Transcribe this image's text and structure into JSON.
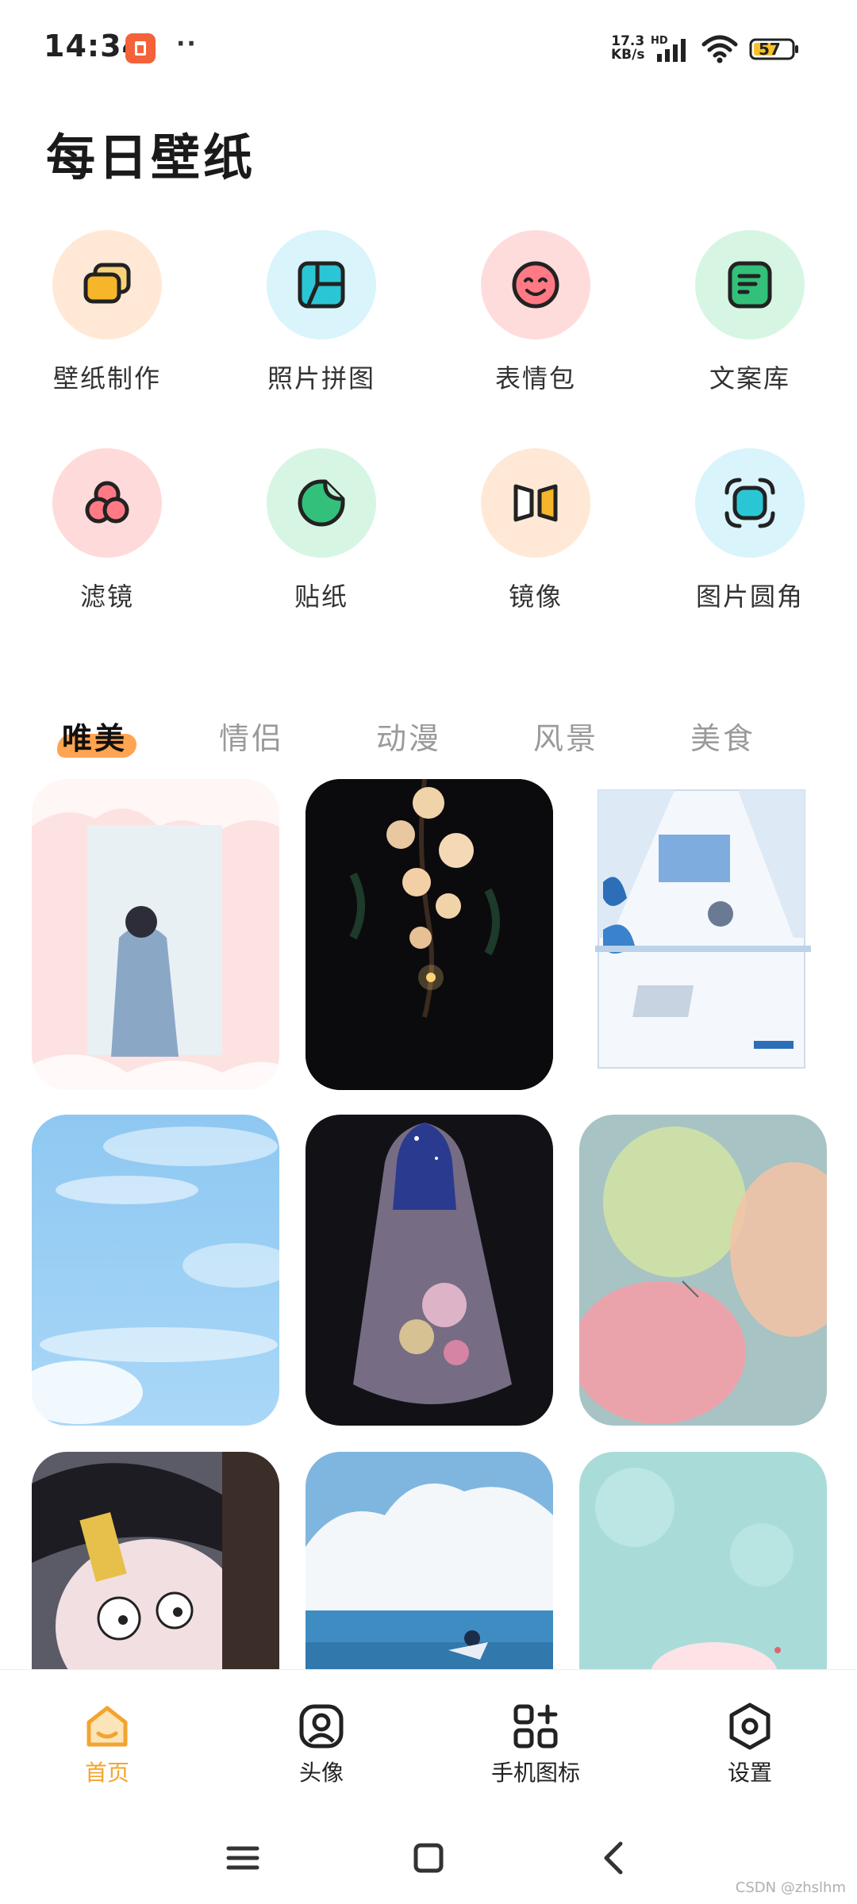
{
  "status_bar": {
    "time": "14:34",
    "net_speed_value": "17.3",
    "net_speed_unit": "KB/s",
    "hd": "HD",
    "battery": "57"
  },
  "page_title": "每日壁纸",
  "features": [
    {
      "label": "壁纸制作",
      "icon": "layers-icon",
      "bg": "#ffe9d6",
      "accent": "#f7b529"
    },
    {
      "label": "照片拼图",
      "icon": "collage-icon",
      "bg": "#d9f4fb",
      "accent": "#2bc6d6"
    },
    {
      "label": "表情包",
      "icon": "smile-icon",
      "bg": "#ffdcdc",
      "accent": "#ff6e79"
    },
    {
      "label": "文案库",
      "icon": "document-icon",
      "bg": "#d6f6e3",
      "accent": "#33c07a"
    },
    {
      "label": "滤镜",
      "icon": "filter-icon",
      "bg": "#ffdada",
      "accent": "#ff6e79"
    },
    {
      "label": "贴纸",
      "icon": "sticker-icon",
      "bg": "#d6f6e3",
      "accent": "#33c07a"
    },
    {
      "label": "镜像",
      "icon": "mirror-icon",
      "bg": "#ffe9d6",
      "accent": "#f7b529"
    },
    {
      "label": "图片圆角",
      "icon": "round-corner-icon",
      "bg": "#d9f4fb",
      "accent": "#2bc6d6"
    }
  ],
  "tabs": [
    "唯美",
    "情侣",
    "动漫",
    "风景",
    "美食"
  ],
  "active_tab": "唯美",
  "bottom_nav": [
    {
      "label": "首页",
      "icon": "home-icon",
      "active": true
    },
    {
      "label": "头像",
      "icon": "avatar-icon",
      "active": false
    },
    {
      "label": "手机图标",
      "icon": "apps-icon",
      "active": false
    },
    {
      "label": "设置",
      "icon": "settings-icon",
      "active": false
    }
  ],
  "watermark": "CSDN @zhslhm",
  "colors": {
    "active": "#f3a430",
    "tab_highlight": "#ff9a3d"
  }
}
